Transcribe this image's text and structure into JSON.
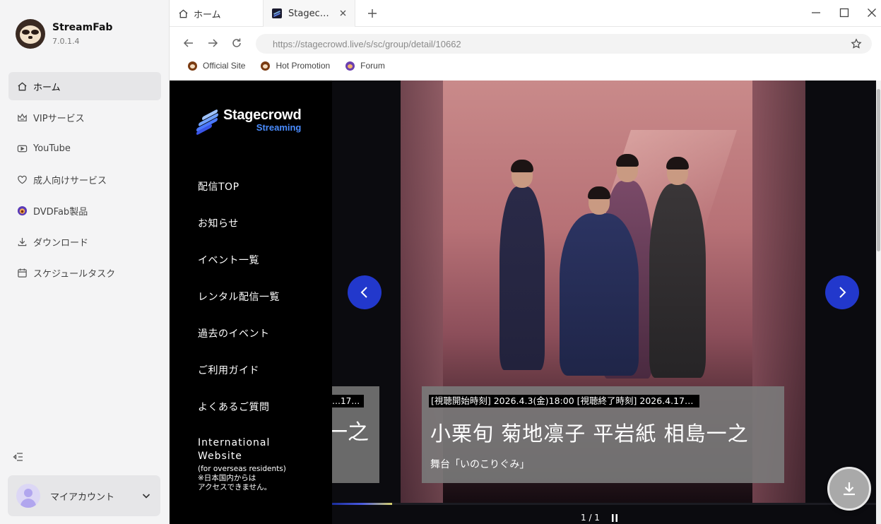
{
  "app": {
    "name": "StreamFab",
    "version": "7.0.1.4"
  },
  "sidebar": {
    "items": [
      {
        "label": "ホーム",
        "icon": "home-icon",
        "active": true
      },
      {
        "label": "VIPサービス",
        "icon": "crown-icon"
      },
      {
        "label": "YouTube",
        "icon": "youtube-icon"
      },
      {
        "label": "成人向けサービス",
        "icon": "heart-icon"
      },
      {
        "label": "DVDFab製品",
        "icon": "dvdfab-icon"
      },
      {
        "label": "ダウンロード",
        "icon": "download-icon"
      },
      {
        "label": "スケジュールタスク",
        "icon": "calendar-icon"
      }
    ],
    "account_label": "マイアカウント"
  },
  "tabs": [
    {
      "label": "ホーム",
      "icon": "home-icon"
    },
    {
      "label": "Stagec…",
      "icon": "stagecrowd-favicon"
    }
  ],
  "address": {
    "url": "https://stagecrowd.live/s/sc/group/detail/10662"
  },
  "bookmarks": [
    {
      "label": "Official Site"
    },
    {
      "label": "Hot Promotion"
    },
    {
      "label": "Forum"
    }
  ],
  "site": {
    "logo_name": "Stagecrowd",
    "logo_sub": "Streaming",
    "menu": [
      "配信TOP",
      "お知らせ",
      "イベント一覧",
      "レンタル配信一覧",
      "過去のイベント",
      "ご利用ガイド",
      "よくあるご質問"
    ],
    "intl_title_1": "International",
    "intl_title_2": "Website",
    "intl_note_1": "(for overseas residents)",
    "intl_note_2": "※日本国内からは",
    "intl_note_3": "アクセスできません。"
  },
  "carousel": {
    "prev_card_time": "…17…",
    "prev_card_title": "一之",
    "card_time": "[視聴開始時刻] 2026.4.3(金)18:00 [視聴終了時刻] 2026.4.17…",
    "card_title": "小栗旬 菊地凛子 平岩紙 相島一之",
    "card_subtitle": "舞台「いのこりぐみ」",
    "pager": "1 / 1",
    "progress": 0.11
  },
  "colors": {
    "accent_blue": "#2238cc",
    "logo_blue": "#4a8cff"
  }
}
